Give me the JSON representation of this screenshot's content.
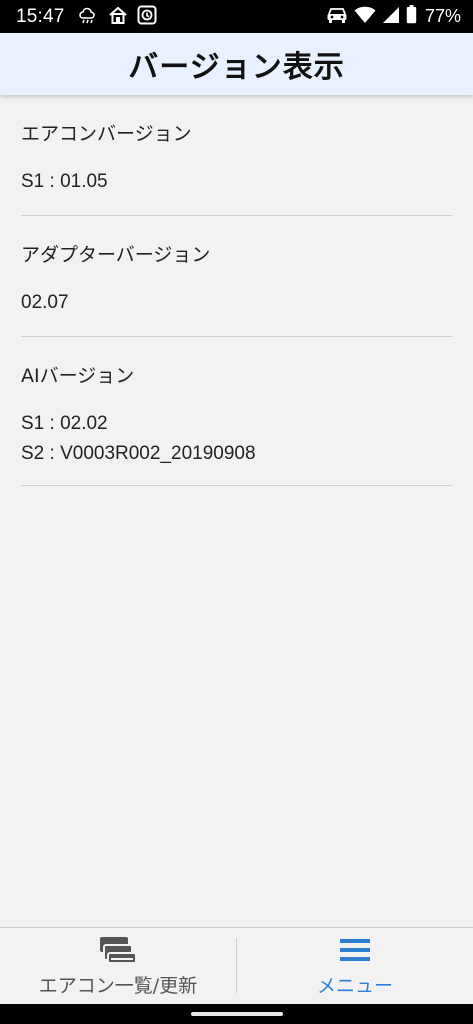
{
  "status_bar": {
    "time": "15:47",
    "battery_percent": "77%"
  },
  "header": {
    "title": "バージョン表示"
  },
  "sections": [
    {
      "title": "エアコンバージョン",
      "lines": [
        "S1 : 01.05"
      ]
    },
    {
      "title": "アダプターバージョン",
      "lines": [
        "02.07"
      ]
    },
    {
      "title": "AIバージョン",
      "lines": [
        "S1 : 02.02",
        "S2 : V0003R002_20190908"
      ]
    }
  ],
  "bottom_nav": {
    "items": [
      {
        "label": "エアコン一覧/更新",
        "icon": "aircon-list-icon",
        "color": "#555555",
        "active": false
      },
      {
        "label": "メニュー",
        "icon": "menu-icon",
        "color": "#2d7fd4",
        "active": true
      }
    ]
  }
}
